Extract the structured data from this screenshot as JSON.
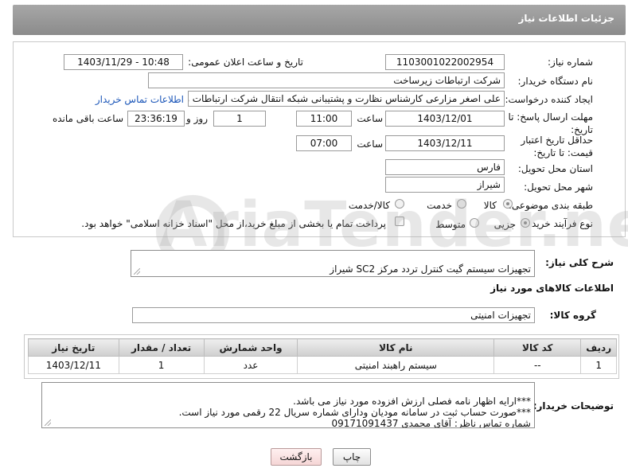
{
  "header": {
    "title": "جزئیات اطلاعات نیاز"
  },
  "form": {
    "need_number_label": "شماره نیاز:",
    "need_number": "1103001022002954",
    "announce_label": "تاریخ و ساعت اعلان عمومی:",
    "announce_value": "1403/11/29 - 10:48",
    "buyer_org_label": "نام دستگاه خریدار:",
    "buyer_org": "شرکت ارتباطات زیرساخت",
    "requester_label": "ایجاد کننده درخواست:",
    "requester": "علی اصغر مزارعی کارشناس نظارت و پشتیبانی شبکه انتقال شرکت ارتباطات زیرساخت",
    "contact_link": "اطلاعات تماس خریدار",
    "reply_deadline_label": "مهلت ارسال پاسخ: تا تاریخ:",
    "reply_date": "1403/12/01",
    "time_label": "ساعت",
    "reply_time": "11:00",
    "days_value": "1",
    "days_label": "روز و",
    "remaining_time": "23:36:19",
    "remaining_label": "ساعت باقی مانده",
    "price_validity_label": "حداقل تاریخ اعتبار قیمت: تا تاریخ:",
    "price_date": "1403/12/11",
    "price_time": "07:00",
    "province_label": "استان محل تحویل:",
    "province": "فارس",
    "city_label": "شهر محل تحویل:",
    "city": "شیراز",
    "category_label": "طبقه بندی موضوعی:",
    "category_options": [
      "کالا",
      "خدمت",
      "کالا/خدمت"
    ],
    "process_label": "نوع فرآیند خرید :",
    "process_options": [
      "جزیی",
      "متوسط"
    ],
    "payment_note": "پرداخت تمام یا بخشی از مبلغ خرید،از محل \"اسناد خزانه اسلامی\" خواهد بود."
  },
  "description": {
    "label": "شرح کلی نیاز:",
    "text": "تجهیزات سیستم گیت کنترل تردد مرکز SC2 شیراز"
  },
  "goods_section": {
    "title": "اطلاعات کالاهای مورد نیاز",
    "group_label": "گروه کالا:",
    "group_value": "تجهیزات امنیتی"
  },
  "table": {
    "headers": [
      "ردیف",
      "کد کالا",
      "نام کالا",
      "واحد شمارش",
      "تعداد / مقدار",
      "تاریخ نیاز"
    ],
    "rows": [
      [
        "1",
        "--",
        "سیستم راهبند امنیتی",
        "عدد",
        "1",
        "1403/12/11"
      ]
    ]
  },
  "buyer_notes": {
    "label": "توضیحات خریدار:",
    "text": "***ارایه اظهار نامه فصلی ارزش افزوده مورد نیاز می باشد.\n***صورت حساب ثبت در سامانه مودیان ودارای شماره سریال 22 رقمی مورد نیاز است.\nشماره تماس ناظر: آقای محمدی 09171091437"
  },
  "buttons": {
    "print": "چاپ",
    "back": "بازگشت"
  },
  "watermark": {
    "text": "AriaTender.neT"
  },
  "colors": {
    "header_bg": "#999999",
    "link": "#1a55b8"
  }
}
